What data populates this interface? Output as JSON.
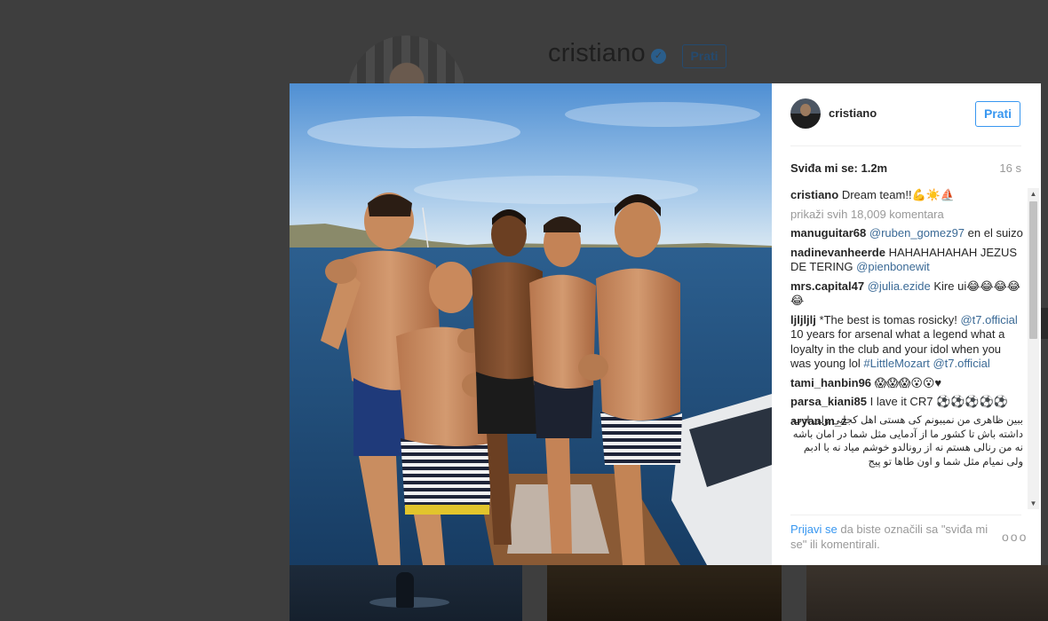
{
  "background_profile": {
    "username": "cristiano",
    "follow_label": "Prati"
  },
  "post": {
    "username": "cristiano",
    "follow_label": "Prati",
    "likes_label": "Sviđa mi se: 1.2m",
    "time": "16 s",
    "caption": {
      "user": "cristiano",
      "text": "Dream team!!💪☀️⛵"
    },
    "view_all_label": "prikaži svih 18,009 komentara",
    "comments": [
      {
        "user": "manuguitar68",
        "mention": "@ruben_gomez97",
        "text": " en el suizo"
      },
      {
        "user": "nadinevanheerde",
        "text": "HAHAHAHAHAH JEZUS DE TERING ",
        "mention": "@pienbonewit"
      },
      {
        "user": "mrs.capital47",
        "mention": "@julia.ezide",
        "text": " Kire ui😂😂😂😂😂"
      },
      {
        "user": "ljljljlj",
        "text1": "*The best is tomas rosicky! ",
        "mention1": "@t7.official",
        "text2": " 10 years for arsenal what a legend what a loyalty in the club and your idol when you was young lol ",
        "mention2": "#LittleMozart",
        "mention3": "@t7.official"
      },
      {
        "user": "tami_hanbin96",
        "text": "😱😱😱😮😮♥"
      },
      {
        "user": "parsa_kiani85",
        "text": "I lave it CR7 ⚽⚽⚽⚽⚽"
      },
      {
        "user": "aryan.m_z",
        "text": "ببین ظاهری من نمیبونم کی هستی اهل کجایی ولی ادب داشته باش تا کشور ما از آدمایی مثل شما در امان باشه نه من رنالی هستم نه از رونالدو خوشم میاد نه با ادبم ولی نمیام مثل شما و اون طاها تو پیج"
      }
    ],
    "footer": {
      "login_label": "Prijavi se",
      "rest": " da biste označili sa \"sviđa mi se\" ili komentirali.",
      "more_label": "ooo"
    }
  }
}
